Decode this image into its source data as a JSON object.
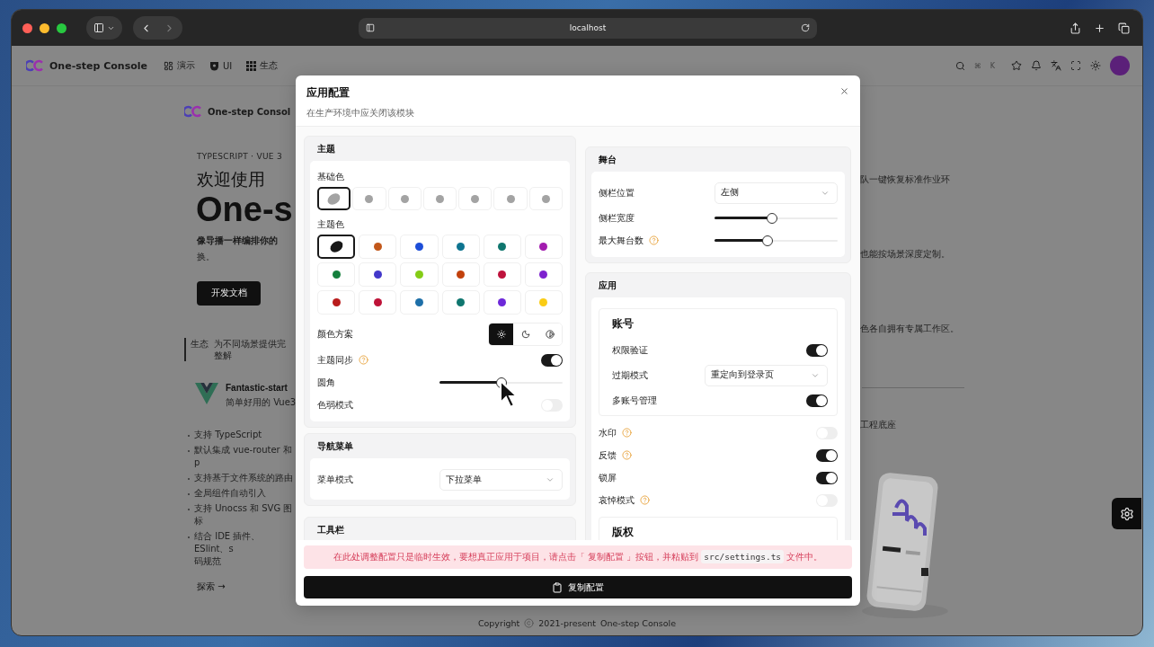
{
  "browser": {
    "address": "localhost"
  },
  "site_header": {
    "brand": "One-step Console",
    "nav": [
      "演示",
      "UI",
      "生态"
    ],
    "shortcut": [
      "⌘",
      "K"
    ]
  },
  "hero": {
    "brand": "One-step Consol",
    "eyebrow": "TYPESCRIPT · VUE 3",
    "heading": "欢迎使用",
    "title": "One-s",
    "tagline": "像导播一样编排你的",
    "tagline_end": "换。",
    "button": "开发文档"
  },
  "ecosystem": {
    "label": "生态",
    "description": "为不同场景提供完整解"
  },
  "starter": {
    "name": "Fantastic-start",
    "description": "简单好用的 Vue3",
    "features": [
      "支持 TypeScript",
      "默认集成 vue-router 和 p",
      "支持基于文件系统的路由",
      "全局组件自动引入",
      "支持 Unocss 和 SVG 图标",
      "结合 IDE 插件、ESlint、s"
    ],
    "feature_wrap": "码规范"
  },
  "explore": "探索 →",
  "side_notes": [
    "队一键恢复标准作业环",
    "也能按场景深度定制。",
    "色各自拥有专属工作区。",
    "工程底座"
  ],
  "footer": {
    "copyright": "Copyright",
    "years": "2021-present",
    "owner": "One-step Console"
  },
  "settings_dialog": {
    "title": "应用配置",
    "subtitle": "在生产环境中应关闭该模块",
    "theme": {
      "title": "主题",
      "base_label": "基础色",
      "base_colors": [
        {
          "color": "#a3a3a3",
          "selected": true
        },
        {
          "color": "#a3a3a3",
          "selected": false
        },
        {
          "color": "#a3a3a3",
          "selected": false
        },
        {
          "color": "#a3a3a3",
          "selected": false
        },
        {
          "color": "#a3a3a3",
          "selected": false
        },
        {
          "color": "#a3a3a3",
          "selected": false
        },
        {
          "color": "#a3a3a3",
          "selected": false
        }
      ],
      "theme_label": "主题色",
      "theme_colors": [
        {
          "color": "#171717",
          "selected": true
        },
        {
          "color": "#c2571a",
          "selected": false
        },
        {
          "color": "#1d4ed8",
          "selected": false
        },
        {
          "color": "#0e7490",
          "selected": false
        },
        {
          "color": "#0f766e",
          "selected": false
        },
        {
          "color": "#a21caf",
          "selected": false
        },
        {
          "color": "#15803d",
          "selected": false
        },
        {
          "color": "#4338ca",
          "selected": false
        },
        {
          "color": "#84cc16",
          "selected": false
        },
        {
          "color": "#c2410c",
          "selected": false
        },
        {
          "color": "#be123c",
          "selected": false
        },
        {
          "color": "#7e22ce",
          "selected": false
        },
        {
          "color": "#b91c1c",
          "selected": false
        },
        {
          "color": "#be1238",
          "selected": false
        },
        {
          "color": "#1d6fa8",
          "selected": false
        },
        {
          "color": "#0f766f",
          "selected": false
        },
        {
          "color": "#6d28d9",
          "selected": false
        },
        {
          "color": "#facc15",
          "selected": false
        }
      ],
      "rows": [
        {
          "kind": "scheme",
          "label": "颜色方案",
          "options": [
            {
              "selected": true
            },
            {
              "selected": false
            },
            {
              "selected": false
            }
          ]
        },
        {
          "kind": "toggle",
          "label": "主题同步",
          "help": true,
          "on": true
        },
        {
          "kind": "slider",
          "label": "圆角",
          "level": 0.5
        },
        {
          "kind": "toggle",
          "label": "色弱模式",
          "on": false
        }
      ]
    },
    "navigation": {
      "title": "导航菜单",
      "rows": [
        {
          "kind": "select",
          "label": "菜单模式",
          "value": "下拉菜单"
        }
      ]
    },
    "toolbar": {
      "title": "工具栏"
    },
    "stage": {
      "title": "舞台",
      "rows": [
        {
          "kind": "select",
          "label": "侧栏位置",
          "value": "左侧"
        },
        {
          "kind": "slider",
          "label": "侧栏宽度",
          "level": 0.47
        },
        {
          "kind": "slider",
          "label": "最大舞台数",
          "help": true,
          "level": 0.43
        }
      ]
    },
    "app": {
      "title": "应用",
      "account": {
        "title": "账号",
        "rows": [
          {
            "kind": "toggle",
            "label": "权限验证",
            "on": true
          },
          {
            "kind": "select",
            "label": "过期模式",
            "value": "重定向到登录页"
          },
          {
            "kind": "toggle",
            "label": "多账号管理",
            "on": true
          }
        ]
      },
      "rows": [
        {
          "kind": "toggle",
          "label": "水印",
          "help": true,
          "on": false
        },
        {
          "kind": "toggle",
          "label": "反馈",
          "help": true,
          "on": true
        },
        {
          "kind": "toggle",
          "label": "锁屏",
          "on": true
        },
        {
          "kind": "toggle",
          "label": "哀悼模式",
          "help": true,
          "on": false
        }
      ],
      "copyright_title": "版权"
    },
    "notice": {
      "before": "在此处调整配置只是临时生效，要想真正应用于项目，请点击「 复制配置 」按钮，并粘贴到",
      "code": "src/settings.ts",
      "after": "文件中。"
    },
    "copy_button": "复制配置"
  }
}
